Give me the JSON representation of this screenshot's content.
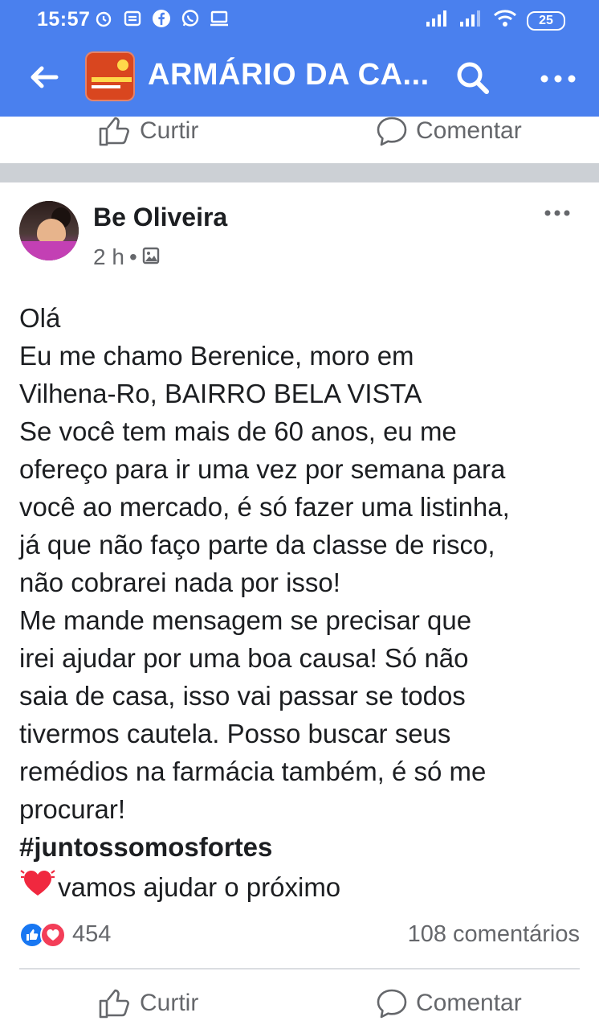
{
  "status_bar": {
    "time": "15:57",
    "battery": "25",
    "left_icons": [
      "alarm-icon",
      "news-icon",
      "facebook-icon",
      "whatsapp-icon",
      "monitor-icon"
    ],
    "right_icons": [
      "signal-icon",
      "signal-icon",
      "wifi-icon",
      "battery-icon"
    ]
  },
  "header": {
    "title": "ARMÁRIO DA CA...",
    "back_icon": "back-arrow-icon",
    "search_icon": "search-icon",
    "more_icon": "more-icon",
    "bg_color": "#4a80ee"
  },
  "previous_post_actions": {
    "like_label": "Curtir",
    "comment_label": "Comentar"
  },
  "post": {
    "author": "Be Oliveira",
    "time": "2 h",
    "privacy_icon": "photo-icon",
    "lines": [
      "Olá",
      "Eu me chamo Berenice, moro em",
      "Vilhena-Ro, BAIRRO  BELA  VISTA",
      "Se você tem mais de 60 anos, eu me",
      "ofereço para ir uma vez por semana para",
      "você ao mercado, é só fazer uma listinha,",
      "já que não faço parte da classe de risco,",
      "não cobrarei nada por isso!",
      "Me mande mensagem se precisar que",
      "irei ajudar por uma boa causa! Só não",
      "saia de casa, isso vai passar se todos",
      "tivermos cautela. Posso buscar seus",
      "remédios na farmácia também, é só me",
      "procurar!"
    ],
    "hashtag": "#juntossomosfortes",
    "closing": "vamos ajudar o próximo",
    "reaction_count": "454",
    "comment_count": "108 comentários",
    "actions": {
      "like_label": "Curtir",
      "comment_label": "Comentar"
    }
  }
}
